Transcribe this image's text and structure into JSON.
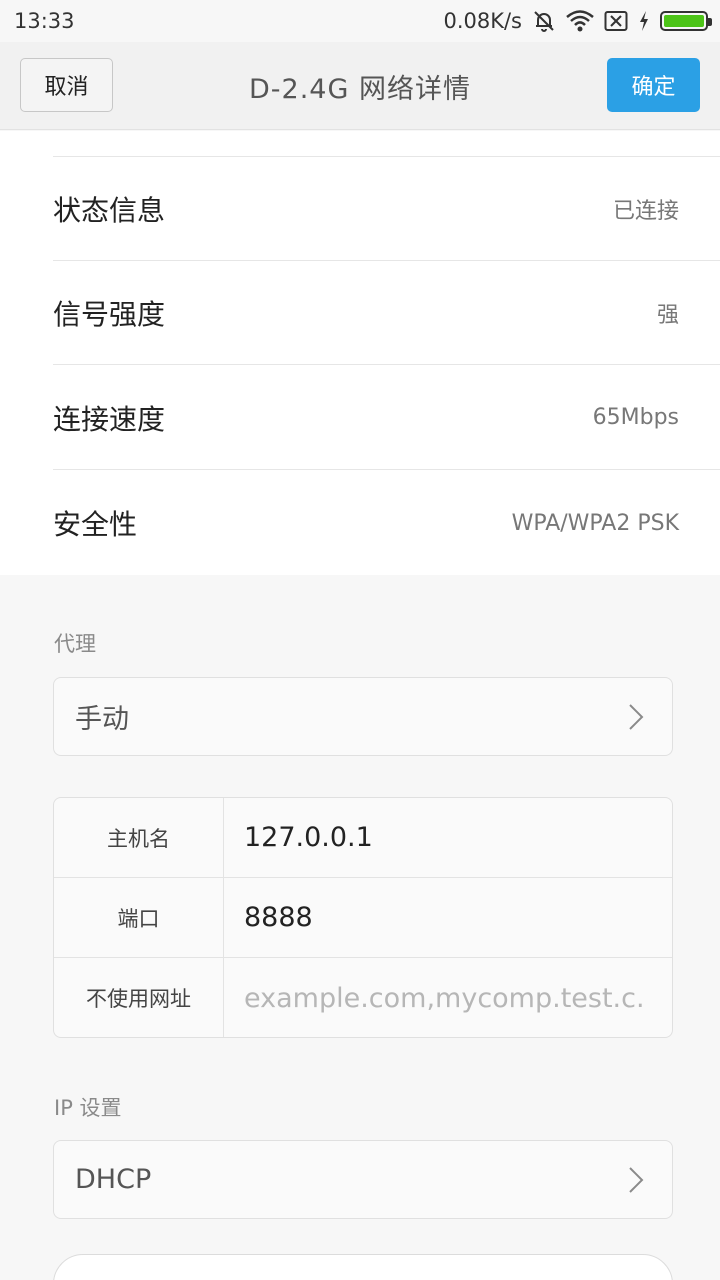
{
  "status_bar": {
    "time": "13:33",
    "net_speed": "0.08K/s",
    "icons": [
      "mute-bell-icon",
      "wifi-icon",
      "no-sim-icon",
      "charging-icon",
      "battery-icon"
    ],
    "battery_level": 1.0,
    "battery_color": "#4cc417"
  },
  "title_bar": {
    "cancel_label": "取消",
    "title": "D-2.4G  网络详情",
    "ok_label": "确定",
    "ok_color": "#2ba0e5"
  },
  "info": {
    "rows": [
      {
        "label": "状态信息",
        "value": "已连接"
      },
      {
        "label": "信号强度",
        "value": "强"
      },
      {
        "label": "连接速度",
        "value": "65Mbps"
      },
      {
        "label": "安全性",
        "value": "WPA/WPA2 PSK"
      }
    ]
  },
  "proxy": {
    "section_label": "代理",
    "mode": "手动",
    "fields": [
      {
        "key": "主机名",
        "value": "127.0.0.1",
        "placeholder": ""
      },
      {
        "key": "端口",
        "value": "8888",
        "placeholder": ""
      },
      {
        "key": "不使用网址",
        "value": "",
        "placeholder": "example.com,mycomp.test.c."
      }
    ]
  },
  "ip_settings": {
    "section_label": "IP 设置",
    "mode": "DHCP"
  }
}
